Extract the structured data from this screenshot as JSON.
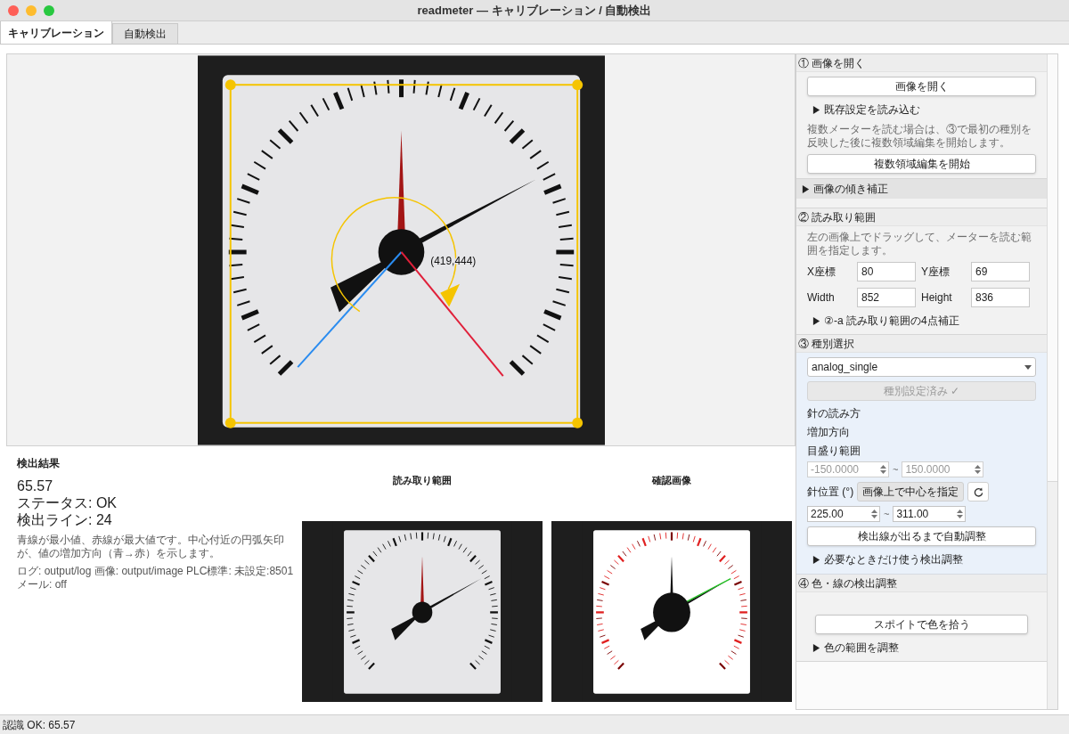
{
  "window": {
    "title": "readmeter — キャリブレーション / 自動検出"
  },
  "tabs": [
    {
      "label": "キャリブレーション",
      "selected": true
    },
    {
      "label": "自動検出",
      "selected": false
    }
  ],
  "image_view": {
    "center_label": "(419,444)"
  },
  "result": {
    "title": "検出結果",
    "value": "65.57",
    "status": "ステータス: OK",
    "lines": "検出ライン: 24",
    "note": "青線が最小値、赤線が最大値です。中心付近の円弧矢印が、値の増加方向（青→赤）を示します。",
    "log": "ログ: output/log  画像: output/image  PLC標準: 未設定:8501 メール: off"
  },
  "previews": [
    {
      "title": "読み取り範囲",
      "kind": "crop"
    },
    {
      "title": "確認画像",
      "kind": "mask"
    }
  ],
  "panel": [
    {
      "header": "① 画像を開く",
      "tinted": false,
      "items": [
        {
          "kind": "button",
          "label": "画像を開く",
          "disabled": false
        },
        {
          "kind": "disclosure",
          "label": "既存設定を読み込む",
          "expanded": false
        },
        {
          "kind": "note",
          "text": "複数メーターを読む場合は、③で最初の種別を反映した後に複数領域編集を開始します。"
        },
        {
          "kind": "button",
          "label": "複数領域編集を開始",
          "disabled": false
        }
      ]
    },
    {
      "header": "画像の傾き補正",
      "collapsible": true,
      "expanded": false,
      "tinted": false
    },
    {
      "header": "② 読み取り範囲",
      "tinted": false,
      "items": [
        {
          "kind": "note",
          "text": "左の画像上でドラッグして、メーターを読む範囲を指定します。"
        },
        {
          "kind": "fields",
          "fields": [
            {
              "label": "X座標",
              "value": "80"
            },
            {
              "label": "Y座標",
              "value": "69"
            },
            {
              "label": "Width",
              "value": "852"
            },
            {
              "label": "Height",
              "value": "836"
            }
          ]
        },
        {
          "kind": "disclosure",
          "label": "②-a 読み取り範囲の4点補正",
          "expanded": false
        }
      ]
    },
    {
      "header": "③ 種別選択",
      "tinted": true,
      "items": [
        {
          "kind": "select",
          "value": "analog_single"
        },
        {
          "kind": "button",
          "label": "種別設定済み ✓",
          "disabled": true
        },
        {
          "kind": "label",
          "text": "針の読み方"
        },
        {
          "kind": "label",
          "text": "増加方向"
        },
        {
          "kind": "label",
          "text": "目盛り範囲"
        },
        {
          "kind": "range",
          "from": "-150.0000",
          "to": "150.0000",
          "separator": "~",
          "disabled": true
        },
        {
          "kind": "needle",
          "label": "針位置 (°)",
          "button": "画像上で中心を指定"
        },
        {
          "kind": "range",
          "from": "225.00",
          "to": "311.00",
          "separator": "~",
          "disabled": false
        },
        {
          "kind": "button",
          "label": "検出線が出るまで自動調整",
          "disabled": false
        },
        {
          "kind": "disclosure",
          "label": "必要なときだけ使う検出調整",
          "expanded": false
        }
      ]
    },
    {
      "header": "④ 色・線の検出調整",
      "tinted": false,
      "items": [
        {
          "kind": "wide_button",
          "label": "スポイトで色を拾う"
        },
        {
          "kind": "disclosure",
          "label": "色の範囲を調整",
          "expanded": false
        }
      ]
    }
  ],
  "status_bar": "認識 OK: 65.57"
}
